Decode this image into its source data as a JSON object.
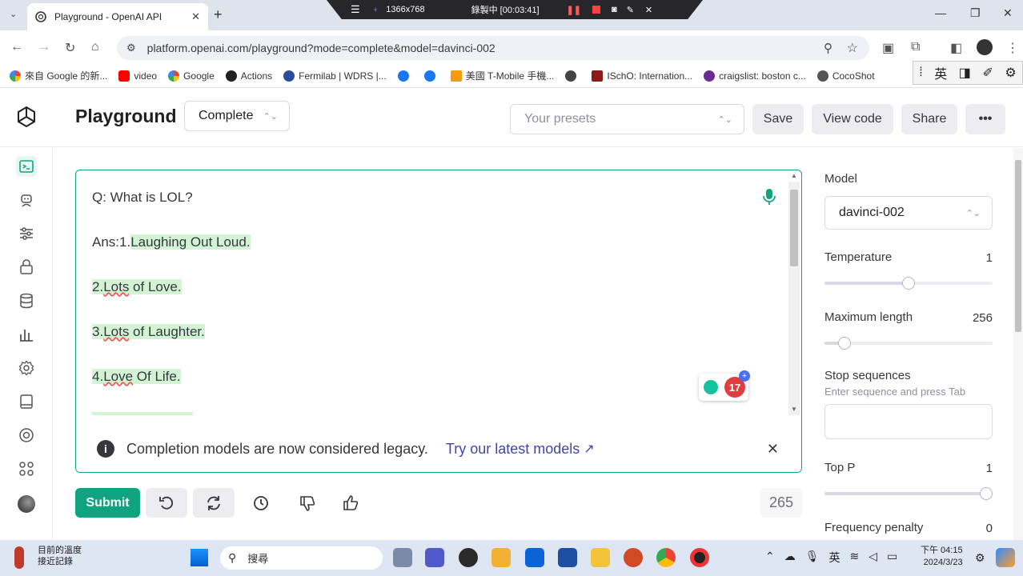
{
  "browser": {
    "tab_title": "Playground - OpenAI API",
    "url": "platform.openai.com/playground?mode=complete&model=davinci-002",
    "bookmarks": [
      {
        "label": "來自 Google 的新...",
        "icon": "google-icon"
      },
      {
        "label": "video",
        "icon": "youtube-icon"
      },
      {
        "label": "Google",
        "icon": "google-icon"
      },
      {
        "label": "Actions",
        "icon": "github-icon"
      },
      {
        "label": "Fermilab | WDRS |...",
        "icon": "fermilab-icon"
      },
      {
        "label": "",
        "icon": "facebook-icon"
      },
      {
        "label": "",
        "icon": "facebook-icon"
      },
      {
        "label": "美國 T-Mobile 手機...",
        "icon": "ct-icon"
      },
      {
        "label": "",
        "icon": "globe-icon"
      },
      {
        "label": "ISchO: Internation...",
        "icon": "ischo-icon"
      },
      {
        "label": "craigslist: boston c...",
        "icon": "peace-icon"
      },
      {
        "label": "CocoShot",
        "icon": "cocoshot-icon"
      }
    ],
    "ime": {
      "lang": "英"
    }
  },
  "recorder": {
    "resolution": "1366x768",
    "status": "錄製中 [00:03:41]"
  },
  "header": {
    "title": "Playground",
    "mode": "Complete",
    "presets_placeholder": "Your presets",
    "save": "Save",
    "view_code": "View code",
    "share": "Share",
    "more": "•••"
  },
  "editor": {
    "question": "Q: What is LOL?",
    "answer_prefix": "Ans:1.",
    "answer_1": "Laughing Out Loud.",
    "item_2_num": "2.",
    "item_2_word": "Lots",
    "item_2_rest": " of Love.",
    "item_3_num": "3.",
    "item_3_word": "Lots",
    "item_3_rest": " of Laughter.",
    "item_4_num": "4.",
    "item_4_word": "Love",
    "item_4_rest": " Of Life.",
    "grammar_count": "17",
    "legacy_notice": "Completion models are now considered legacy.",
    "legacy_link": "Try our latest models"
  },
  "toolbar": {
    "submit": "Submit",
    "token_count": "265"
  },
  "settings": {
    "model_label": "Model",
    "model_value": "davinci-002",
    "temperature_label": "Temperature",
    "temperature_value": "1",
    "temperature_level": 0.5,
    "max_length_label": "Maximum length",
    "max_length_value": "256",
    "max_length_level": 0.12,
    "stop_label": "Stop sequences",
    "stop_hint": "Enter sequence and press Tab",
    "top_p_label": "Top P",
    "top_p_value": "1",
    "top_p_level": 1.0,
    "freq_label": "Frequency penalty",
    "freq_value": "0"
  },
  "taskbar": {
    "weather_title": "目前的溫度",
    "weather_sub": "接近記錄",
    "search_placeholder": "搜尋",
    "ime": "英",
    "time": "下午 04:15",
    "date": "2024/3/23",
    "accent": "#10a37f"
  }
}
